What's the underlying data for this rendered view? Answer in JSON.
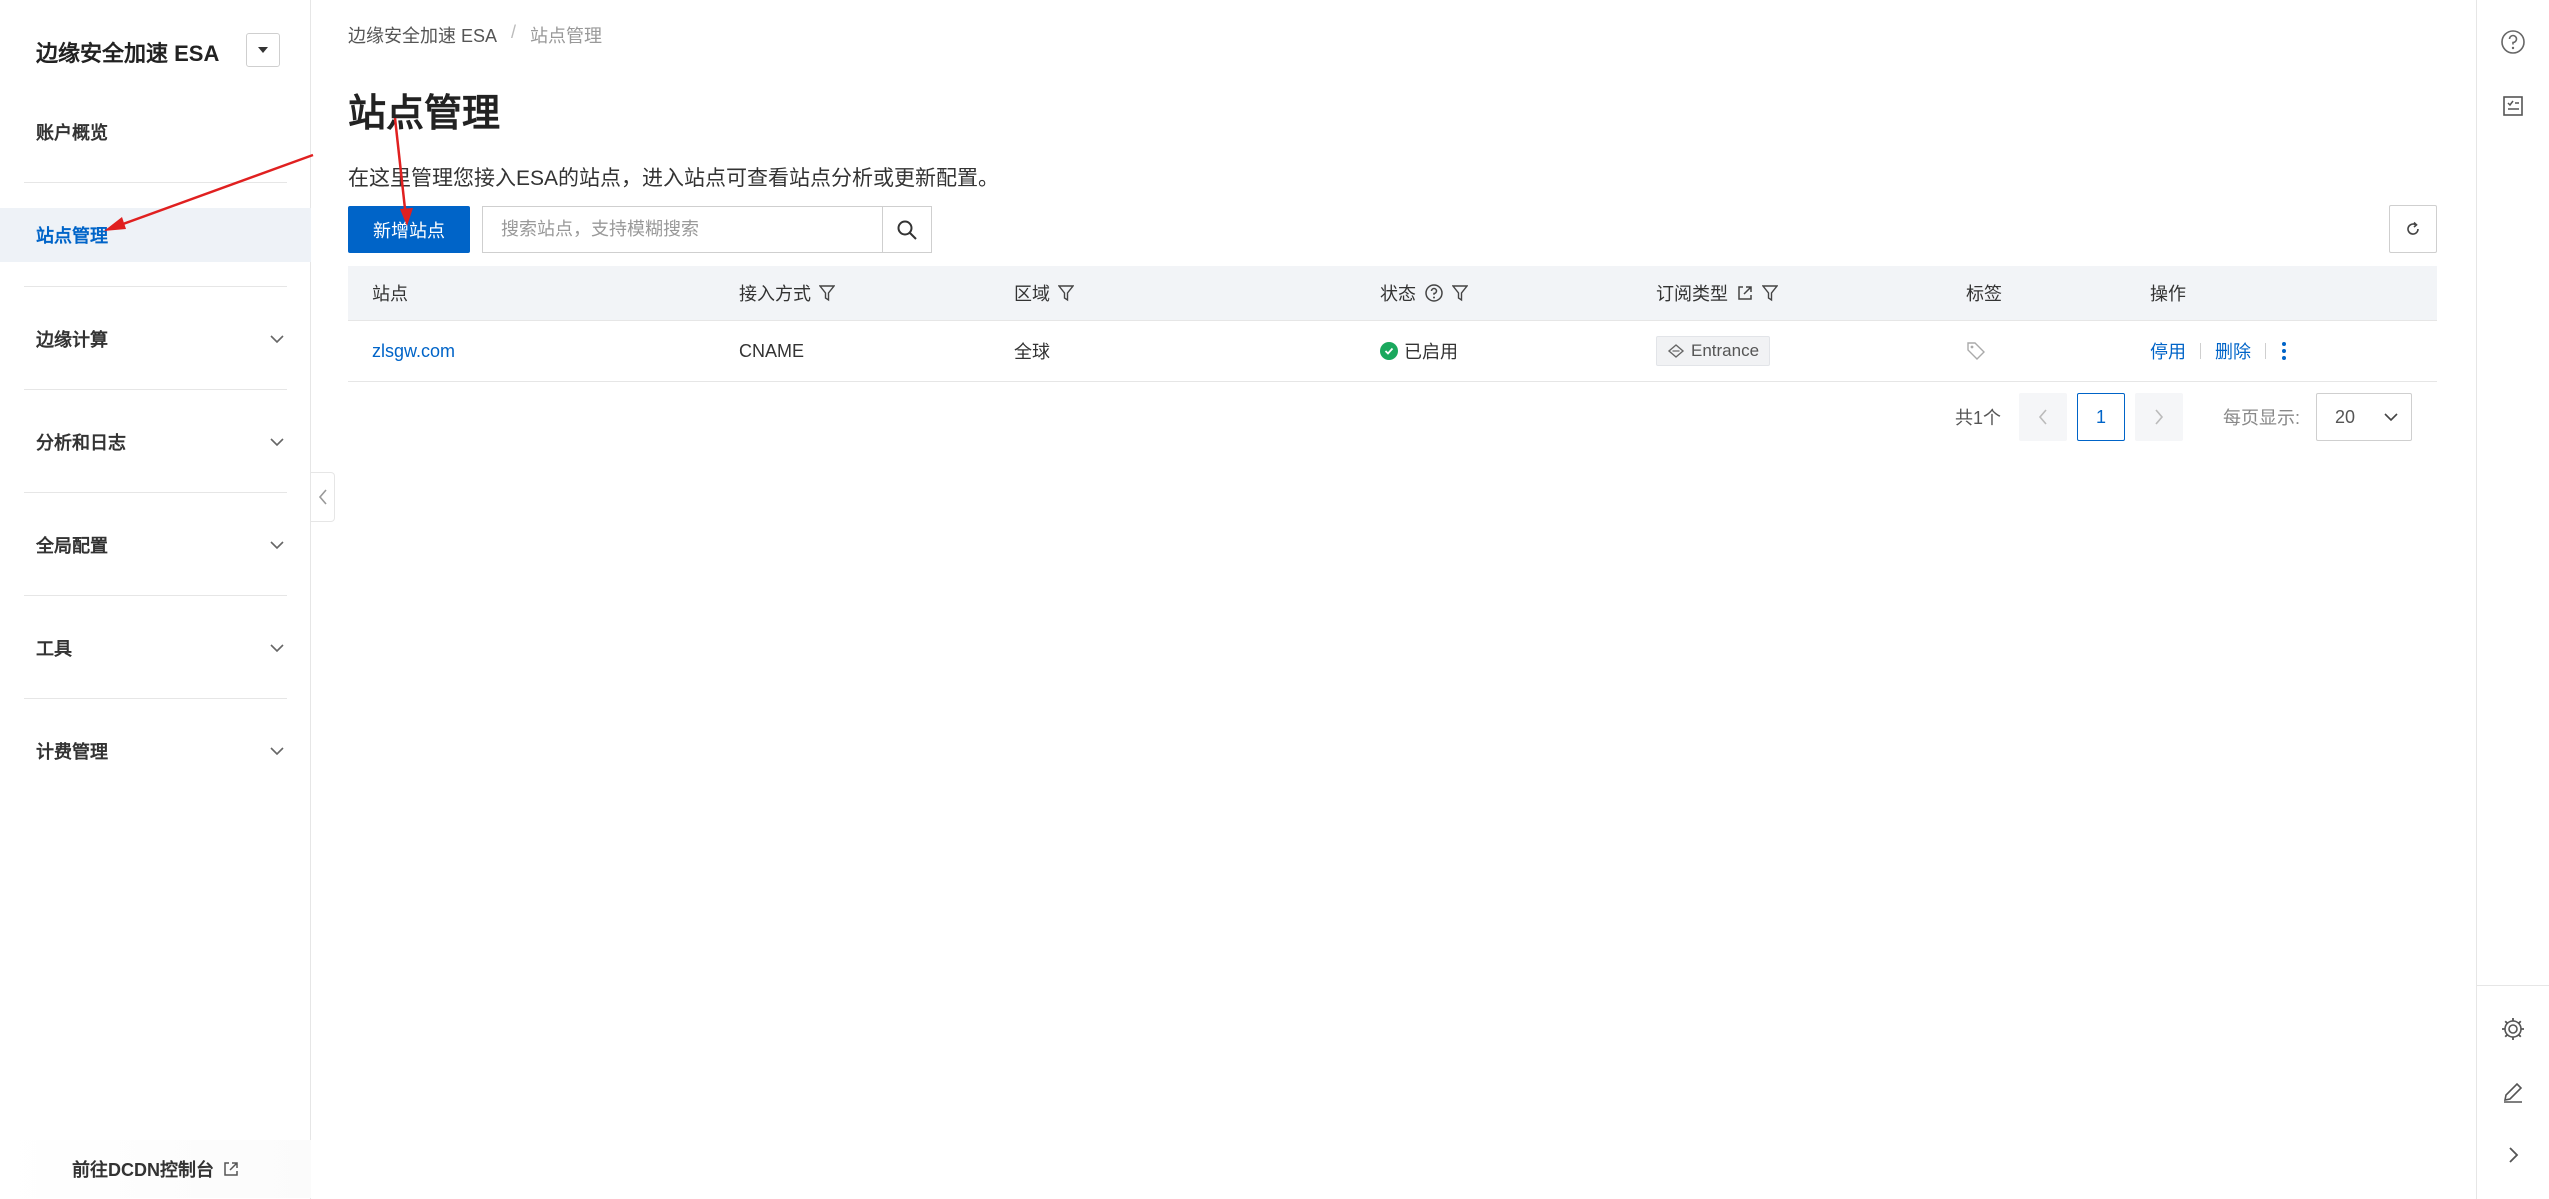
{
  "sidebar": {
    "brand": "边缘安全加速 ESA",
    "items": [
      {
        "label": "账户概览"
      },
      {
        "label": "站点管理"
      },
      {
        "label": "边缘计算"
      },
      {
        "label": "分析和日志"
      },
      {
        "label": "全局配置"
      },
      {
        "label": "工具"
      },
      {
        "label": "计费管理"
      }
    ],
    "dcdn_link": "前往DCDN控制台"
  },
  "breadcrumb": [
    "边缘安全加速 ESA",
    "站点管理"
  ],
  "page": {
    "title": "站点管理",
    "description": "在这里管理您接入ESA的站点，进入站点可查看站点分析或更新配置。"
  },
  "toolbar": {
    "add_button": "新增站点",
    "search_placeholder": "搜索站点，支持模糊搜索"
  },
  "table": {
    "headers": [
      "站点",
      "接入方式",
      "区域",
      "状态",
      "订阅类型",
      "标签",
      "操作"
    ],
    "rows": [
      {
        "site": "zlsgw.com",
        "access": "CNAME",
        "region": "全球",
        "status": "已启用",
        "plan": "Entrance",
        "op_disable": "停用",
        "op_delete": "删除"
      }
    ]
  },
  "pagination": {
    "total": "共1个",
    "current_page": "1",
    "page_size_label": "每页显示:",
    "page_size": "20"
  },
  "colors": {
    "primary": "#0064c8",
    "success": "#1aa85d",
    "annotation": "#e02020"
  }
}
